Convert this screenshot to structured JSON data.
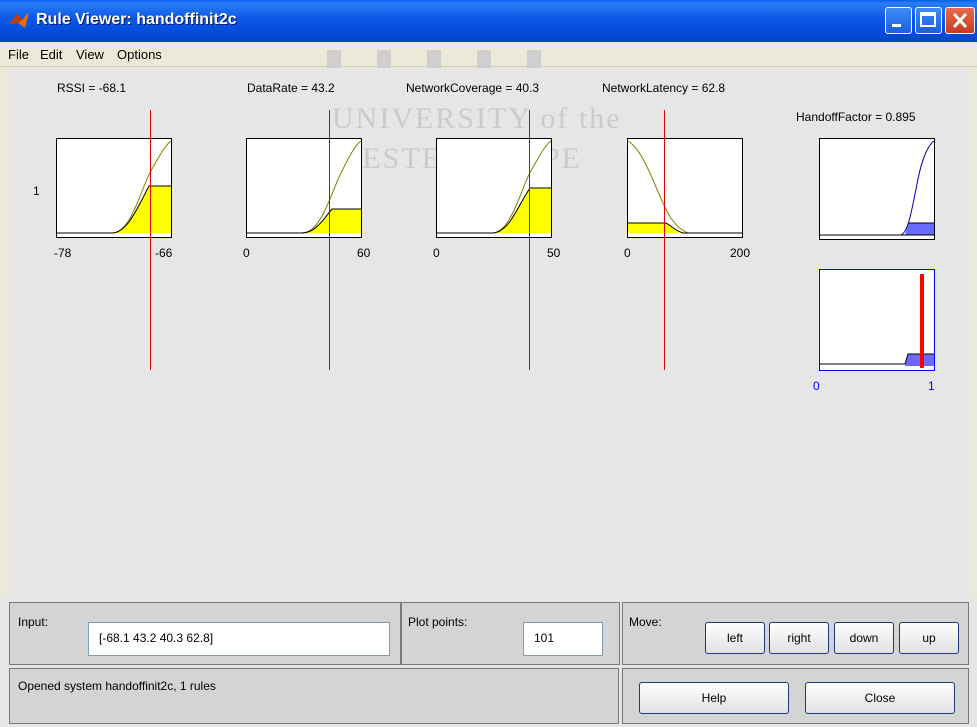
{
  "window": {
    "title": "Rule Viewer: handoffinit2c",
    "watermark_line1": "UNIVERSITY of the",
    "watermark_line2": "WESTERN CAPE"
  },
  "menu": [
    "File",
    "Edit",
    "View",
    "Options"
  ],
  "inputs": [
    {
      "label": "RSSI = -68.1",
      "min_label": "-78",
      "max_label": "-66",
      "min": -78,
      "max": -66,
      "value": -68.1,
      "fill_level": 0.53
    },
    {
      "label": "DataRate = 43.2",
      "min_label": "0",
      "max_label": "60",
      "min": 0,
      "max": 60,
      "value": 43.2,
      "fill_level": 0.28
    },
    {
      "label": "NetworkCoverage = 40.3",
      "min_label": "0",
      "max_label": "50",
      "min": 0,
      "max": 50,
      "value": 40.3,
      "fill_level": 0.5
    },
    {
      "label": "NetworkLatency = 62.8",
      "min_label": "0",
      "max_label": "200",
      "min": 0,
      "max": 200,
      "value": 62.8,
      "fill_level": 0.13
    }
  ],
  "rule_number": "1",
  "output": {
    "label": "HandoffFactor = 0.895",
    "min_label": "0",
    "max_label": "1",
    "value": 0.895,
    "fill_level": 0.13
  },
  "controls": {
    "input_label": "Input:",
    "input_value": "[-68.1 43.2 40.3 62.8]",
    "plot_points_label": "Plot points:",
    "plot_points_value": "101",
    "move_label": "Move:",
    "move_buttons": [
      "left",
      "right",
      "down",
      "up"
    ],
    "status": "Opened system handoffinit2c, 1 rules",
    "help_label": "Help",
    "close_label": "Close"
  },
  "colors": {
    "fill_input": "#ffff00",
    "fill_output": "#6a6aff",
    "indicator_line": "#e00000",
    "output_bar": "#ff0000",
    "curve": "#808000"
  },
  "icons": [
    "matlab-logo-icon",
    "minimize-icon",
    "maximize-icon",
    "close-icon"
  ]
}
